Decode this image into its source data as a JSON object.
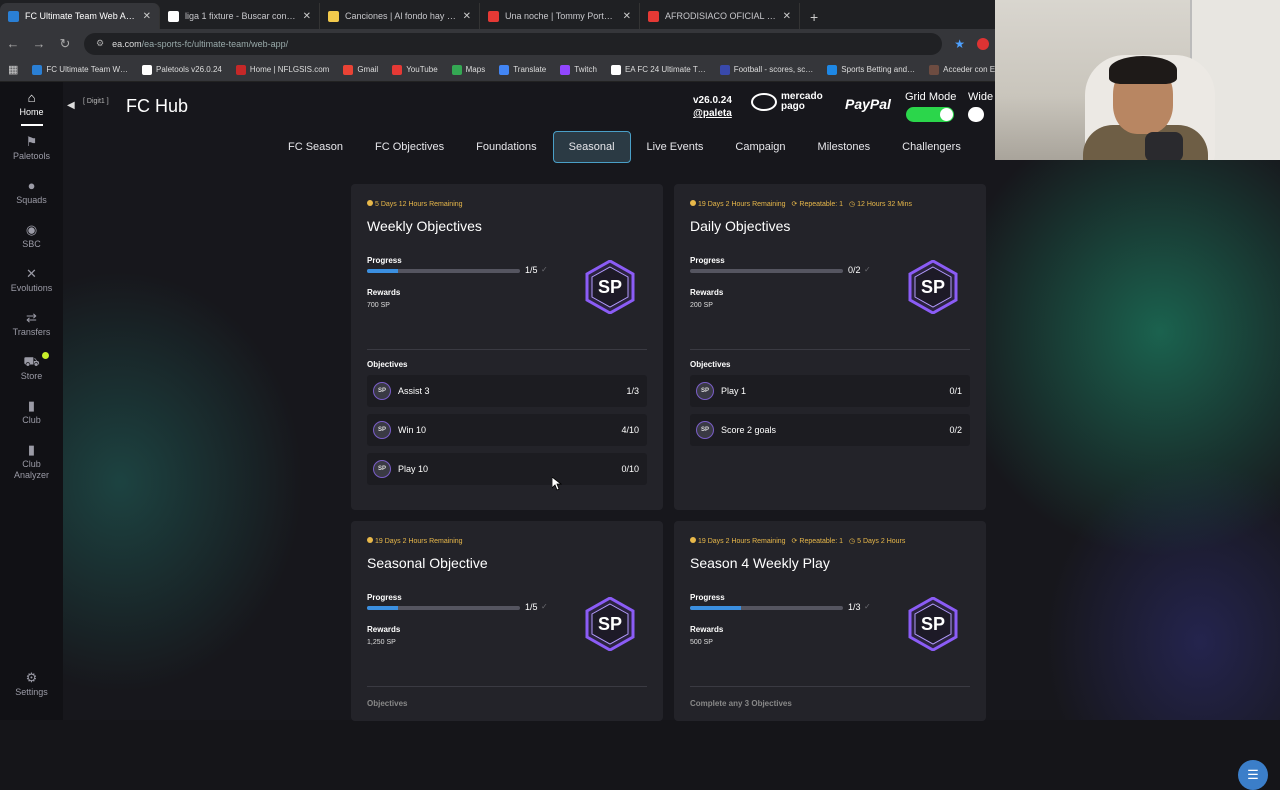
{
  "browser": {
    "tabs": [
      {
        "title": "FC Ultimate Team Web App - E…",
        "color": "#2a7fd4",
        "active": true
      },
      {
        "title": "liga 1 fixture - Buscar con Goog…",
        "color": "#ffffff",
        "active": false
      },
      {
        "title": "Canciones | Al fondo hay sitio …",
        "color": "#f2c94c",
        "active": false
      },
      {
        "title": "Una noche | Tommy Portugal (…",
        "color": "#e53935",
        "active": false
      },
      {
        "title": "AFRODISIACO OFICIAL - YouTu…",
        "color": "#e53935",
        "active": false
      }
    ],
    "new_tab": "+",
    "url_domain": "ea.com",
    "url_path": "/ea-sports-fc/ultimate-team/web-app/",
    "bookmarks": [
      {
        "label": "FC Ultimate Team W…",
        "color": "#2a7fd4"
      },
      {
        "label": "Paletools v26.0.24",
        "color": "#ffffff"
      },
      {
        "label": "Home | NFLGSIS.com",
        "color": "#c62828"
      },
      {
        "label": "Gmail",
        "color": "#ea4335"
      },
      {
        "label": "YouTube",
        "color": "#e53935"
      },
      {
        "label": "Maps",
        "color": "#34a853"
      },
      {
        "label": "Translate",
        "color": "#4285f4"
      },
      {
        "label": "Twitch",
        "color": "#9146ff"
      },
      {
        "label": "EA FC 24 Ultimate T…",
        "color": "#ffffff"
      },
      {
        "label": "Football - scores, sc…",
        "color": "#3949ab"
      },
      {
        "label": "Sports Betting and…",
        "color": "#1e88e5"
      },
      {
        "label": "Acceder con Ellucia…",
        "color": "#6d4c41"
      }
    ]
  },
  "sidenav": {
    "items": [
      {
        "label": "Home",
        "icon": "⌂"
      },
      {
        "label": "Paletools",
        "icon": "⚑"
      },
      {
        "label": "Squads",
        "icon": "●"
      },
      {
        "label": "SBC",
        "icon": "◉"
      },
      {
        "label": "Evolutions",
        "icon": "✕"
      },
      {
        "label": "Transfers",
        "icon": "⇄"
      },
      {
        "label": "Store",
        "icon": "⛟"
      },
      {
        "label": "Club",
        "icon": "▮"
      },
      {
        "label": "Club Analyzer",
        "icon": "▮"
      }
    ],
    "settings_label": "Settings"
  },
  "header": {
    "back_label": "[ Digit1 ]",
    "title": "FC Hub",
    "version": "v26.0.24",
    "handle": "@paleta",
    "mercado_top": "mercado",
    "mercado_bottom": "pago",
    "paypal": "PayPal",
    "grid_mode": "Grid Mode",
    "wide": "Wide"
  },
  "tabs": [
    "FC Season",
    "FC Objectives",
    "Foundations",
    "Seasonal",
    "Live Events",
    "Campaign",
    "Milestones",
    "Challengers"
  ],
  "active_tab": "Seasonal",
  "colors": {
    "accent": "#3b8fe0",
    "timer": "#e8b84a",
    "toggle_on": "#2bd64b"
  },
  "cards": [
    {
      "timer": "5 Days 12 Hours Remaining",
      "repeatable": "",
      "extra_timer": "",
      "title": "Weekly Objectives",
      "progress_label": "Progress",
      "progress": "1/5",
      "progress_fraction": 0.2,
      "rewards_label": "Rewards",
      "rewards": "700 SP",
      "objectives_label": "Objectives",
      "objectives": [
        {
          "name": "Assist 3",
          "value": "1/3"
        },
        {
          "name": "Win 10",
          "value": "4/10"
        },
        {
          "name": "Play 10",
          "value": "0/10"
        }
      ]
    },
    {
      "timer": "19 Days 2 Hours Remaining",
      "repeatable": "Repeatable: 1",
      "extra_timer": "12 Hours 32 Mins",
      "title": "Daily Objectives",
      "progress_label": "Progress",
      "progress": "0/2",
      "progress_fraction": 0,
      "rewards_label": "Rewards",
      "rewards": "200 SP",
      "objectives_label": "Objectives",
      "objectives": [
        {
          "name": "Play 1",
          "value": "0/1"
        },
        {
          "name": "Score 2 goals",
          "value": "0/2"
        }
      ]
    },
    {
      "timer": "19 Days 2 Hours Remaining",
      "repeatable": "",
      "extra_timer": "",
      "title": "Seasonal Objective",
      "progress_label": "Progress",
      "progress": "1/5",
      "progress_fraction": 0.2,
      "rewards_label": "Rewards",
      "rewards": "1,250 SP",
      "objectives_label": "Objectives",
      "objectives": []
    },
    {
      "timer": "19 Days 2 Hours Remaining",
      "repeatable": "Repeatable: 1",
      "extra_timer": "5 Days 2 Hours",
      "title": "Season 4 Weekly Play",
      "progress_label": "Progress",
      "progress": "1/3",
      "progress_fraction": 0.333,
      "rewards_label": "Rewards",
      "rewards": "500 SP",
      "objectives_label": "Complete any 3 Objectives",
      "objectives": []
    }
  ],
  "sp_badge_text": "SP",
  "chip_text": "SP"
}
